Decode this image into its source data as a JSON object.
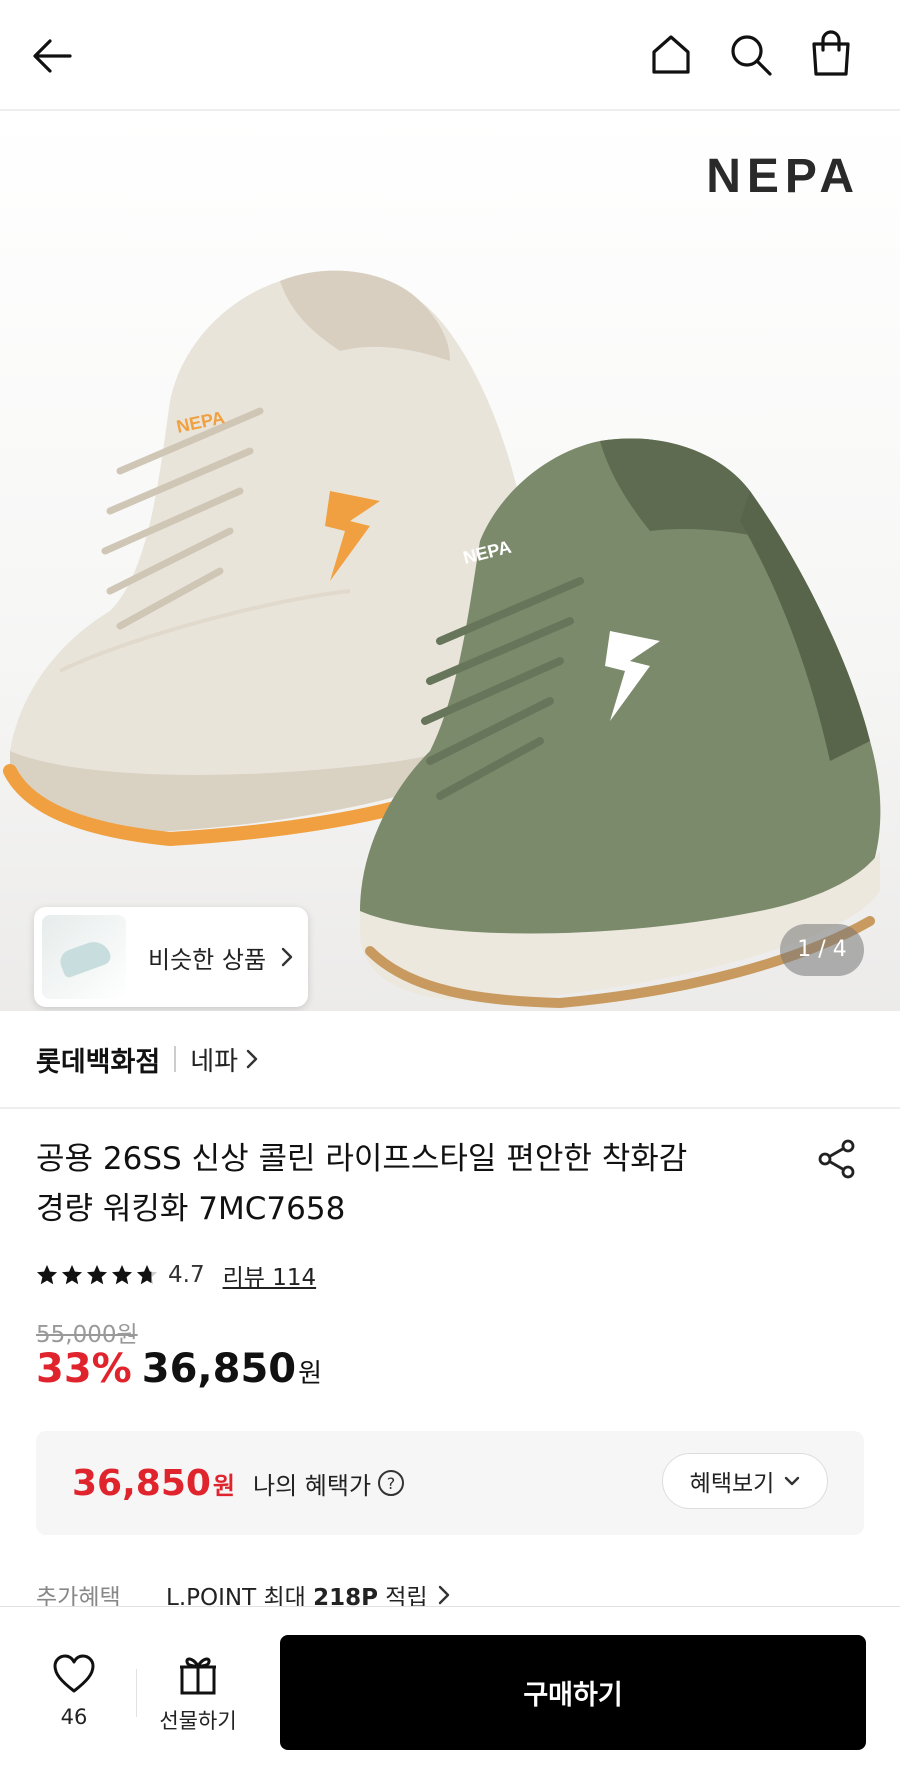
{
  "header": {
    "back_icon": "arrow-left-icon",
    "home_icon": "home-icon",
    "search_icon": "search-icon",
    "bag_icon": "shopping-bag-icon"
  },
  "hero": {
    "brand_logo": "NEPA",
    "shoe_logo": "NEPA",
    "similar_label": "비슷한 상품",
    "pager": "1 / 4"
  },
  "store": {
    "department": "롯데백화점",
    "brand": "네파"
  },
  "product": {
    "title_line1": "공용 26SS 신상 콜린 라이프스타일 편안한 착화감",
    "title_line2": "경량 워킹화 7MC7658",
    "rating": "4.7",
    "stars": 4.7,
    "reviews_label": "리뷰 114",
    "original_price": "55,000원",
    "discount": "33%",
    "price": "36,850",
    "currency": "원"
  },
  "benefit": {
    "price": "36,850",
    "currency": "원",
    "label": "나의 혜택가",
    "button_label": "혜택보기"
  },
  "extra": {
    "label": "추가혜택",
    "text_prefix": "L.POINT 최대 ",
    "points": "218P",
    "text_suffix": " 적립"
  },
  "bottom_bar": {
    "wish_count": "46",
    "gift_label": "선물하기",
    "buy_label": "구매하기"
  },
  "colors": {
    "accent_red": "#e0242d",
    "buy_button": "#000000",
    "shoe_beige": "#e8e2d6",
    "shoe_olive": "#7b8a6a",
    "sole_orange": "#f0a040"
  }
}
